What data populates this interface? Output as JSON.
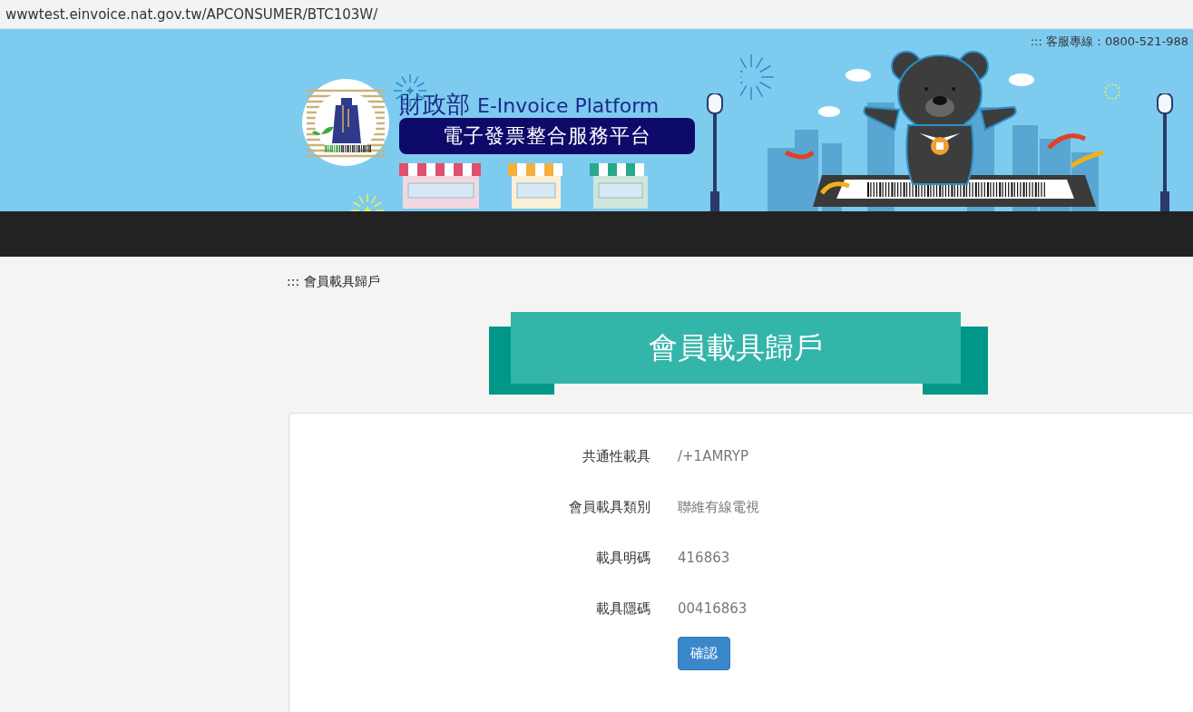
{
  "address_bar": {
    "url": "wwwtest.einvoice.nat.gov.tw/APCONSUMER/BTC103W/"
  },
  "header": {
    "hotline": "::: 客服專線：0800-521-988",
    "agency": "財政部",
    "platform": "E-Invoice Platform",
    "subtitle": "電子發票整合服務平台"
  },
  "breadcrumb": "::: 會員載具歸戶",
  "page_title": "會員載具歸戶",
  "fields": [
    {
      "label": "共通性載具",
      "value": "/+1AMRYP"
    },
    {
      "label": "會員載具類別",
      "value": "聯維有線電視"
    },
    {
      "label": "載具明碼",
      "value": "416863"
    },
    {
      "label": "載具隱碼",
      "value": "00416863"
    }
  ],
  "buttons": [
    {
      "label": "確認"
    }
  ]
}
